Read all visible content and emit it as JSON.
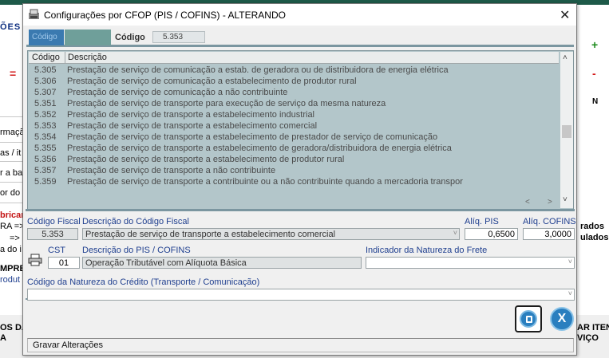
{
  "background": {
    "title_fragment": "ÕES E",
    "left_labels": [
      "rmaçã",
      "as / it",
      "r a bas",
      "or do",
      "bricar",
      "RA =>",
      "=> (",
      "a do i",
      "MPRE",
      "rodut"
    ],
    "right_labels": [
      "rados",
      "ulados"
    ],
    "bottom_left": [
      "OS DA",
      "A"
    ],
    "bottom_right": [
      "AR ITEN",
      "VIÇO"
    ],
    "plus_symbol": "+",
    "minus_symbol": "-",
    "equals_symbol": "=",
    "n_label": "N"
  },
  "dialog": {
    "title": "Configurações por CFOP (PIS / COFINS)   -   ALTERANDO",
    "close_symbol": "✕"
  },
  "header": {
    "tab_label": "Código",
    "code_label": "Código",
    "code_value": "5.353"
  },
  "grid": {
    "columns": [
      "Código",
      "Descrição"
    ],
    "rows": [
      {
        "code": "5.305",
        "desc": "Prestação de serviço de comunicação a estab. de geradora ou de distribuidora de energia elétrica"
      },
      {
        "code": "5.306",
        "desc": "Prestação de serviço de comunicação a estabelecimento de produtor rural"
      },
      {
        "code": "5.307",
        "desc": "Prestação de serviço de comunicação a não contribuinte"
      },
      {
        "code": "5.351",
        "desc": "Prestação de serviço de transporte para execução de serviço da mesma natureza"
      },
      {
        "code": "5.352",
        "desc": "Prestação de serviço de transporte a estabelecimento industrial"
      },
      {
        "code": "5.353",
        "desc": "Prestação de serviço de transporte a estabelecimento comercial"
      },
      {
        "code": "5.354",
        "desc": "Prestação de serviço de transporte a estabelecimento de prestador de serviço de comunicação"
      },
      {
        "code": "5.355",
        "desc": "Prestação de serviço de transporte a estabelecimento de geradora/distribuidora de energia elétrica"
      },
      {
        "code": "5.356",
        "desc": "Prestação de serviço de transporte a estabelecimento de produtor rural"
      },
      {
        "code": "5.357",
        "desc": "Prestação de serviço de transporte a não contribuinte"
      },
      {
        "code": "5.359",
        "desc": "Prestação de serviço de transporte a contribuinte ou a não contribuinte quando a mercadoria transpor"
      }
    ]
  },
  "form": {
    "codigo_fiscal_label": "Código Fiscal",
    "codigo_fiscal_value": "5.353",
    "descricao_cf_label": "Descrição do Código Fiscal",
    "descricao_cf_value": "Prestação de serviço de transporte a estabelecimento comercial",
    "aliq_pis_label": "Alíq. PIS",
    "aliq_pis_value": "0,6500",
    "aliq_cofins_label": "Alíq. COFINS",
    "aliq_cofins_value": "3,0000",
    "cst_label": "CST",
    "cst_value": "01",
    "descricao_pis_label": "Descrição do PIS / COFINS",
    "descricao_pis_value": "Operação Tributável com Alíquota Básica",
    "natureza_frete_label": "Indicador da Natureza do Frete",
    "natureza_frete_value": "",
    "natureza_credito_label": "Código da Natureza do Crédito (Transporte / Comunicação)",
    "natureza_credito_value": ""
  },
  "status_bar": {
    "text": "Gravar Alterações"
  }
}
